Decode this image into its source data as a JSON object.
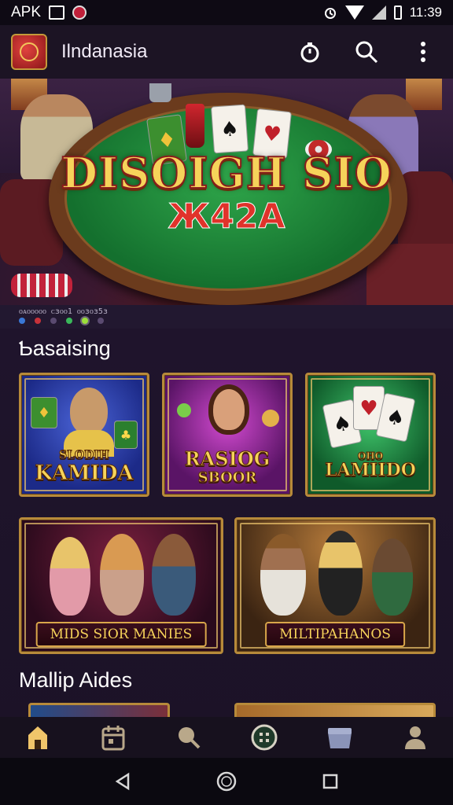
{
  "status_bar": {
    "carrier_label": "APK",
    "time": "11:39",
    "icons": [
      "screenshot-icon",
      "app-notification-icon",
      "alarm-icon",
      "wifi-icon",
      "signal-icon",
      "battery-icon"
    ]
  },
  "app_bar": {
    "title": "Ilndanasia",
    "actions": [
      "timer-icon",
      "search-icon",
      "more-vert-icon"
    ]
  },
  "hero": {
    "logo_text": "DISOIGH SIO",
    "sub_text": "Ж42A",
    "pager_caption": "ᴏᴀᴏᴏᴏᴏᴏ ᴄɜᴏᴏ1 ᴏᴏɜᴏɜ5ɜ",
    "page_count": 6,
    "active_page": 5,
    "dot_colors": [
      "#3a78d6",
      "#c8323a",
      "#5a4a70",
      "#3ab85a",
      "#9ce03a",
      "#5a4a70"
    ]
  },
  "sections": [
    {
      "title": "Ƅasaising",
      "tiles": [
        {
          "name": "game-tile-kamida",
          "label_top": "SLODIH",
          "label_bottom": "KAMIDA"
        },
        {
          "name": "game-tile-rasiog",
          "label_top": "RASIOG",
          "label_bottom": "SBOOR"
        },
        {
          "name": "game-tile-lamiido",
          "label_top": "OHO",
          "label_bottom": "LAMIIDO"
        },
        {
          "name": "game-tile-mids",
          "label_top": "",
          "label_bottom": "MIDS SIOR MANIES"
        },
        {
          "name": "game-tile-multipahanos",
          "label_top": "",
          "label_bottom": "MILTIPAHANOS"
        }
      ]
    },
    {
      "title": "Mallip Aides"
    }
  ],
  "bottom_nav": {
    "items": [
      "home-icon",
      "calendar-icon",
      "racket-icon",
      "casino-chip-icon",
      "treasure-icon",
      "profile-icon"
    ],
    "active": "home-icon"
  },
  "system_nav": {
    "items": [
      "back-icon",
      "home-circle-icon",
      "recents-icon"
    ]
  },
  "colors": {
    "background": "#1e1428",
    "accent_gold": "#f6d35a",
    "felt_green": "#14702e",
    "nav_active": "#f0c56a"
  }
}
